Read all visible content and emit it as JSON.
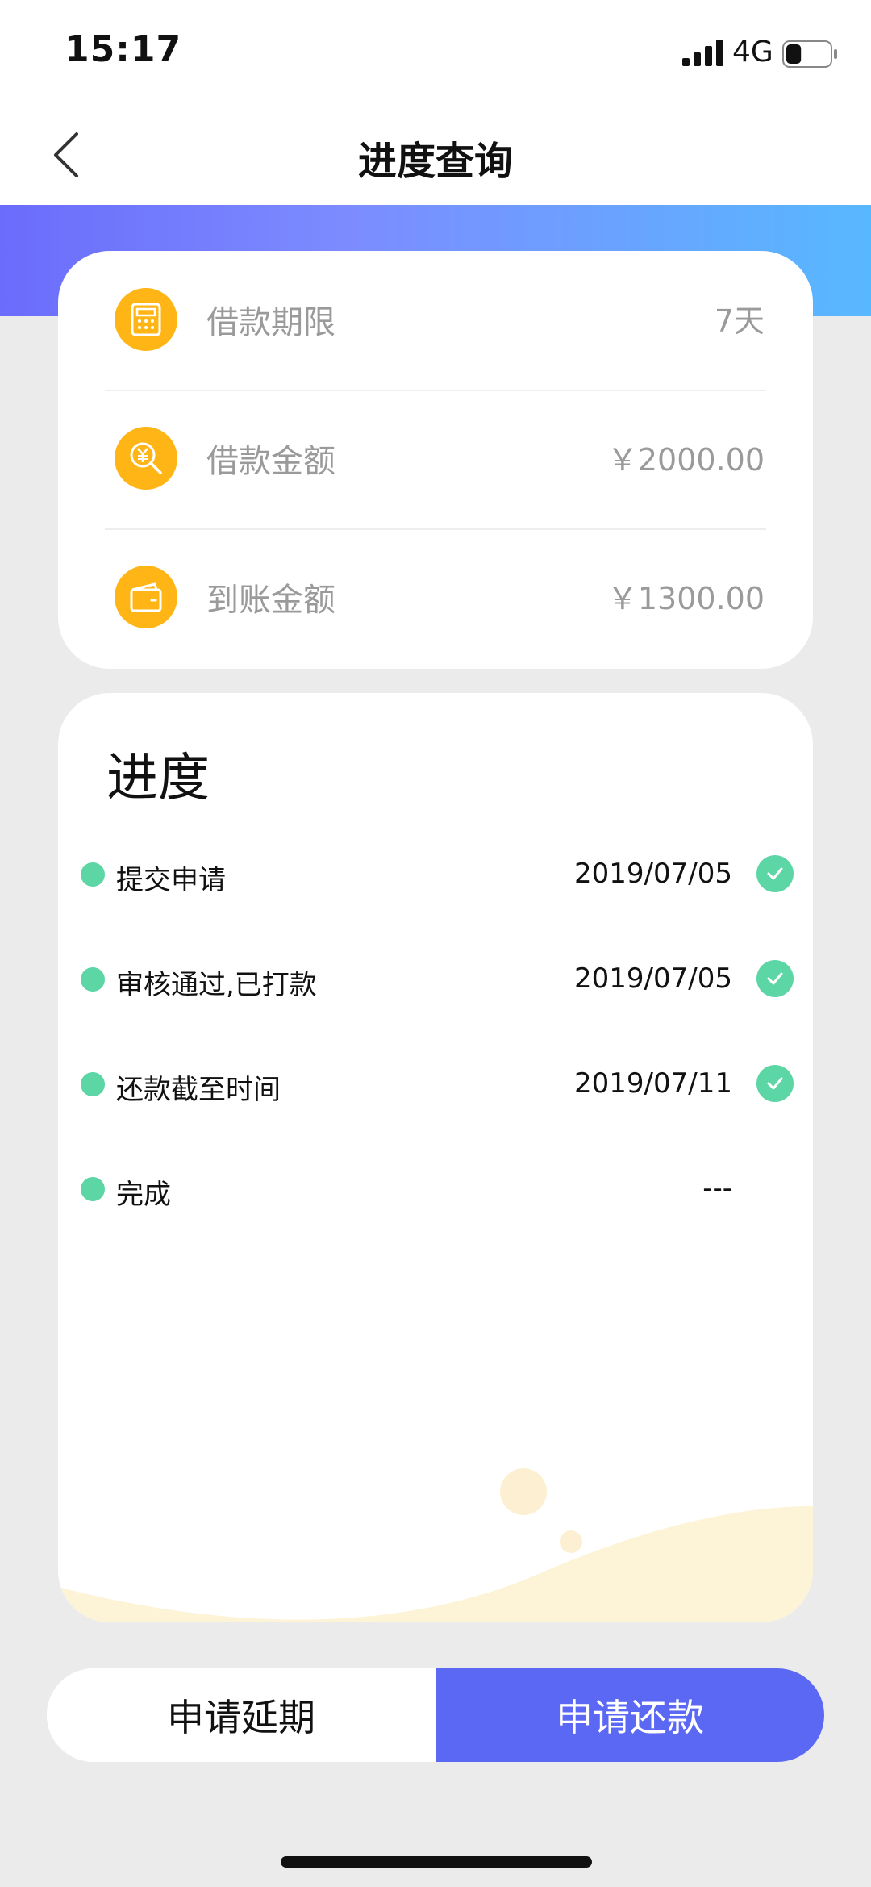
{
  "status_bar": {
    "time": "15:17",
    "network": "4G",
    "battery_level": 0.35
  },
  "nav": {
    "title": "进度查询",
    "back_icon": "chevron-left-icon"
  },
  "colors": {
    "accent": "#5b68f4",
    "gradient_start": "#6b6cfb",
    "gradient_end": "#58b8ff",
    "icon_orange": "#ffb516",
    "step_green": "#5dd6a6",
    "wave_cream": "#fdf3d7"
  },
  "info": {
    "items": [
      {
        "icon": "calculator-icon",
        "label": "借款期限",
        "value": "7天"
      },
      {
        "icon": "yen-search-icon",
        "label": "借款金额",
        "value": "￥2000.00"
      },
      {
        "icon": "wallet-icon",
        "label": "到账金额",
        "value": "￥1300.00"
      }
    ]
  },
  "progress": {
    "title": "进度",
    "steps": [
      {
        "label": "提交申请",
        "date": "2019/07/05",
        "done": true
      },
      {
        "label": "审核通过,已打款",
        "date": "2019/07/05",
        "done": true
      },
      {
        "label": "还款截至时间",
        "date": "2019/07/11",
        "done": true
      },
      {
        "label": "完成",
        "date": "---",
        "done": false
      }
    ]
  },
  "actions": {
    "extend_label": "申请延期",
    "repay_label": "申请还款"
  }
}
